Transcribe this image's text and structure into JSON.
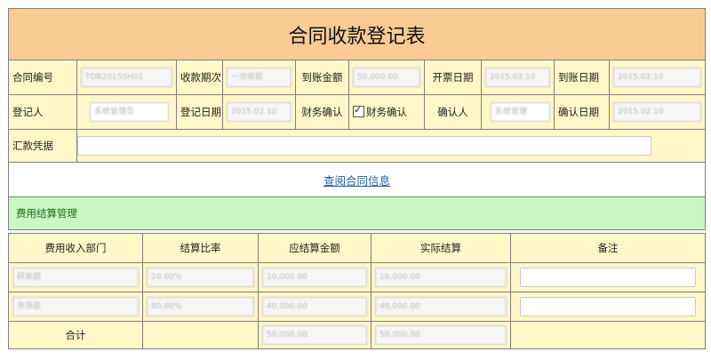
{
  "title": "合同收款登记表",
  "row1": {
    "contract_no_label": "合同编号",
    "contract_no_value": "TDB2015SH01",
    "period_label": "收款期次",
    "period_value": "一次收款",
    "amount_label": "到账金额",
    "amount_value": "50,000.00",
    "invoice_date_label": "开票日期",
    "invoice_date_value": "2015.02.10",
    "arrival_date_label": "到账日期",
    "arrival_date_value": "2015.02.10"
  },
  "row2": {
    "registrant_label": "登记人",
    "registrant_value": "系统管理员",
    "reg_date_label": "登记日期",
    "reg_date_value": "2015.02.10",
    "finance_confirm_label": "财务确认",
    "finance_confirm_checkbox_label": "财务确认",
    "confirmer_label": "确认人",
    "confirmer_value": "系统管理",
    "confirm_date_label": "确认日期",
    "confirm_date_value": "2015.02.10"
  },
  "row3": {
    "voucher_label": "汇款凭据",
    "voucher_value": ""
  },
  "link_text": "查阅合同信息",
  "section_title": "费用结算管理",
  "table": {
    "headers": [
      "费用收入部门",
      "结算比率",
      "应结算金额",
      "实际结算",
      "备注"
    ],
    "rows": [
      {
        "dept": "研发部",
        "ratio": "20.00%",
        "due": "10,000.00",
        "actual": "10,000.00",
        "note": ""
      },
      {
        "dept": "市场部",
        "ratio": "80.00%",
        "due": "40,000.00",
        "actual": "40,000.00",
        "note": ""
      }
    ],
    "total_label": "合计",
    "total_due": "50,000.00",
    "total_actual": "50,000.00"
  }
}
